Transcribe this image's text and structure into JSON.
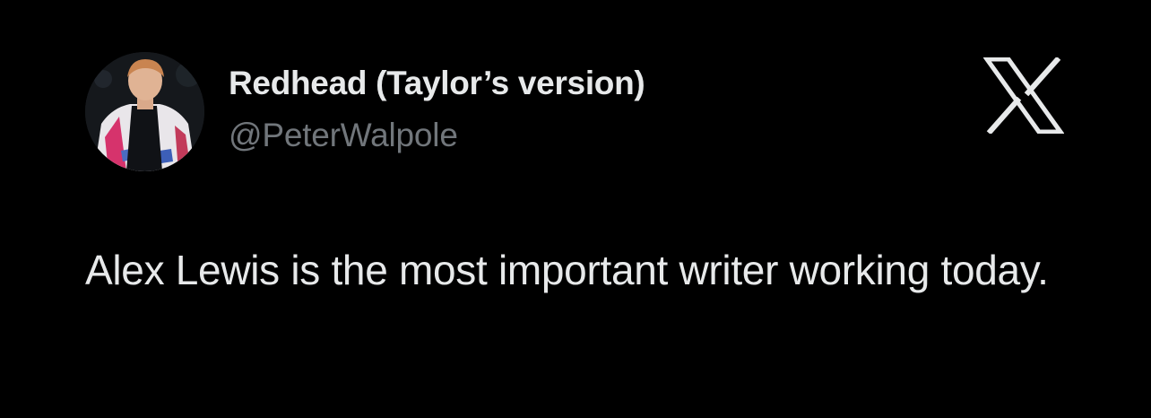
{
  "author": {
    "display_name": "Redhead (Taylor’s version)",
    "handle": "@PeterWalpole",
    "avatar_icon": "profile-photo"
  },
  "brand": {
    "logo_icon": "x-logo-icon",
    "logo_color": "#e7e9ea"
  },
  "tweet": {
    "text": "Alex Lewis is the most important writer working today."
  },
  "colors": {
    "background": "#000000",
    "primary_text": "#e7e9ea",
    "secondary_text": "#71767b"
  }
}
